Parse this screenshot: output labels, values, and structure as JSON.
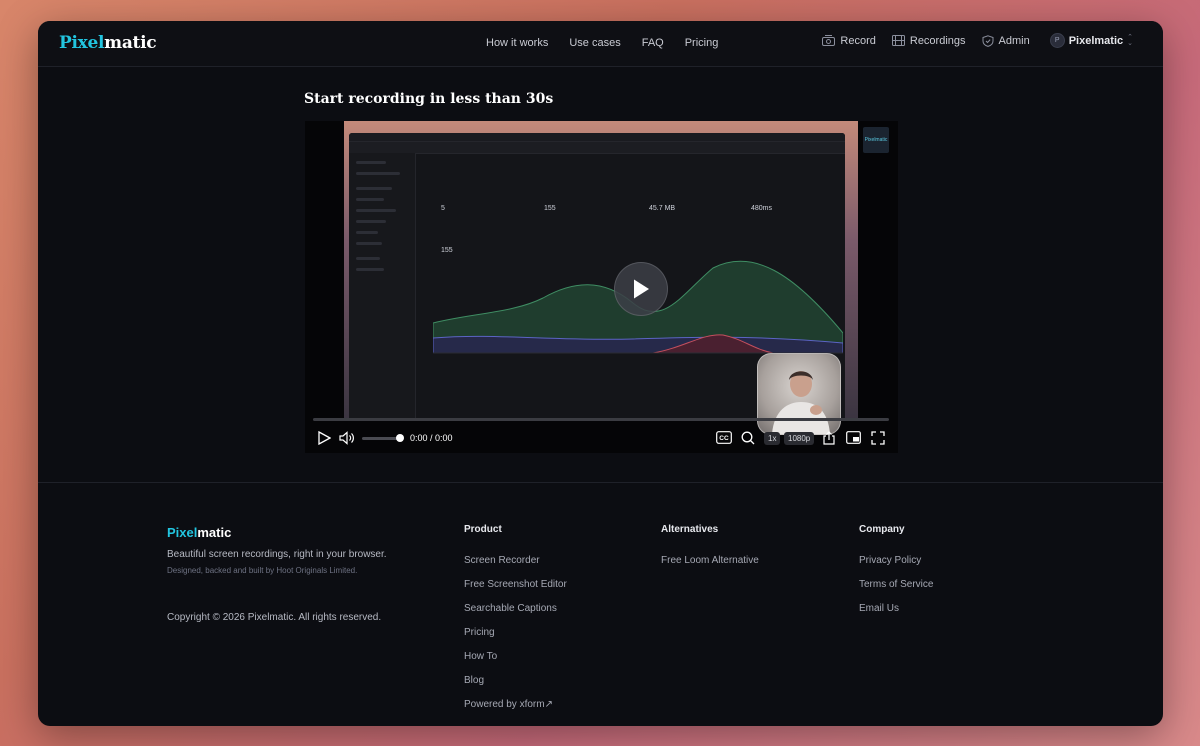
{
  "header": {
    "logo_a": "Pixel",
    "logo_b": "matic",
    "nav": [
      "How it works",
      "Use cases",
      "FAQ",
      "Pricing"
    ],
    "record": "Record",
    "recordings": "Recordings",
    "admin": "Admin",
    "avatar_initial": "P",
    "user": "Pixelmatic"
  },
  "main": {
    "headline": "Start recording in less than 30s",
    "video": {
      "time": "0:00 / 0:00",
      "speed": "1x",
      "quality": "1080p",
      "progress": 0,
      "volume": 0.9,
      "thumb_stats": [
        "5",
        "155",
        "45.7 MB",
        "480ms"
      ],
      "thumb_total": "155",
      "thumb_logo": "Pixelmatic"
    }
  },
  "footer": {
    "logo_a": "Pixel",
    "logo_b": "matic",
    "tagline": "Beautiful screen recordings, right in your browser.",
    "sub": "Designed, backed and built by Hoot Originals Limited.",
    "copyright": "Copyright © 2026 Pixelmatic. All rights reserved.",
    "product": {
      "title": "Product",
      "links": [
        "Screen Recorder",
        "Free Screenshot Editor",
        "Searchable Captions",
        "Pricing",
        "How To",
        "Blog",
        "Powered by xform↗"
      ]
    },
    "alternatives": {
      "title": "Alternatives",
      "links": [
        "Free Loom Alternative"
      ]
    },
    "company": {
      "title": "Company",
      "links": [
        "Privacy Policy",
        "Terms of Service",
        "Email Us"
      ]
    }
  },
  "colors": {
    "accent": "#22c5e0",
    "window_bg": "#0c0d12"
  }
}
